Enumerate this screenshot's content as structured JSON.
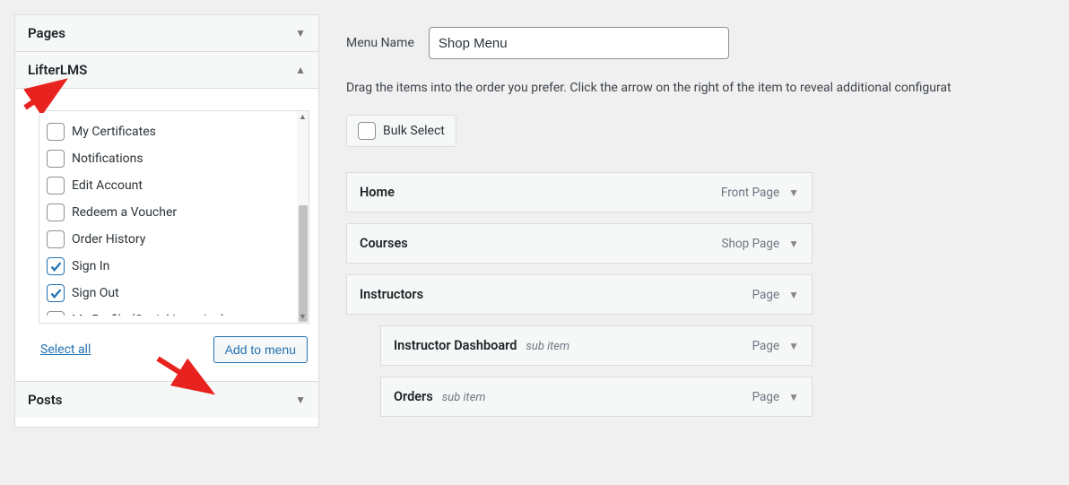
{
  "sidebar": {
    "panels": {
      "pages": {
        "label": "Pages"
      },
      "lifterlms": {
        "label": "LifterLMS",
        "items": [
          {
            "label": "My Certificates",
            "checked": false
          },
          {
            "label": "Notifications",
            "checked": false
          },
          {
            "label": "Edit Account",
            "checked": false
          },
          {
            "label": "Redeem a Voucher",
            "checked": false
          },
          {
            "label": "Order History",
            "checked": false
          },
          {
            "label": "Sign In",
            "checked": true
          },
          {
            "label": "Sign Out",
            "checked": true
          },
          {
            "label": "My Profile (Social Learning)",
            "checked": false
          }
        ],
        "select_all": "Select all",
        "add_button": "Add to menu"
      },
      "posts": {
        "label": "Posts"
      }
    }
  },
  "main": {
    "menu_name_label": "Menu Name",
    "menu_name_value": "Shop Menu",
    "description": "Drag the items into the order you prefer. Click the arrow on the right of the item to reveal additional configurat",
    "bulk_select": "Bulk Select",
    "sub_item_text": "sub item",
    "menu_items": [
      {
        "title": "Home",
        "type": "Front Page",
        "sub": false
      },
      {
        "title": "Courses",
        "type": "Shop Page",
        "sub": false
      },
      {
        "title": "Instructors",
        "type": "Page",
        "sub": false
      },
      {
        "title": "Instructor Dashboard",
        "type": "Page",
        "sub": true
      },
      {
        "title": "Orders",
        "type": "Page",
        "sub": true
      }
    ]
  }
}
